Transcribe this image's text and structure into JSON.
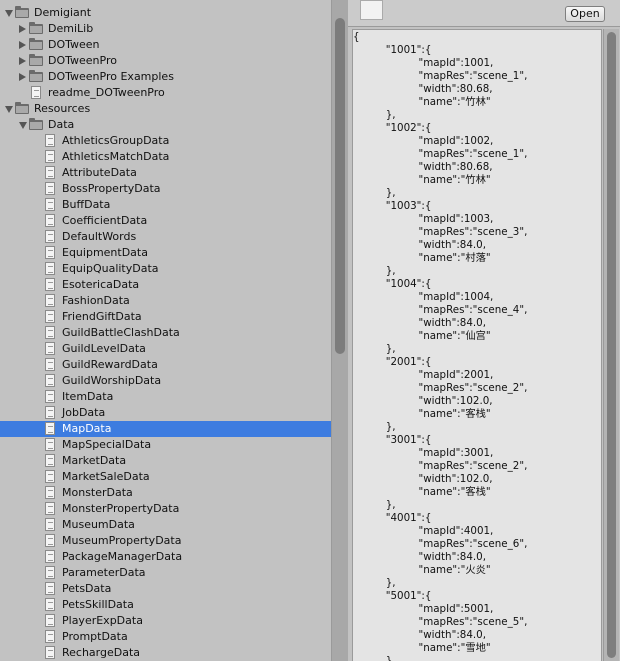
{
  "project_tree": [
    {
      "label": "Demigiant",
      "type": "folder",
      "depth": 0,
      "expander": "down"
    },
    {
      "label": "DemiLib",
      "type": "folder",
      "depth": 1,
      "expander": "right"
    },
    {
      "label": "DOTween",
      "type": "folder",
      "depth": 1,
      "expander": "right"
    },
    {
      "label": "DOTweenPro",
      "type": "folder",
      "depth": 1,
      "expander": "right"
    },
    {
      "label": "DOTweenPro Examples",
      "type": "folder",
      "depth": 1,
      "expander": "right"
    },
    {
      "label": "readme_DOTweenPro",
      "type": "file",
      "depth": 1
    },
    {
      "label": "Resources",
      "type": "folder",
      "depth": 0,
      "expander": "down"
    },
    {
      "label": "Data",
      "type": "folder",
      "depth": 1,
      "expander": "down"
    },
    {
      "label": "AthleticsGroupData",
      "type": "file",
      "depth": 2
    },
    {
      "label": "AthleticsMatchData",
      "type": "file",
      "depth": 2
    },
    {
      "label": "AttributeData",
      "type": "file",
      "depth": 2
    },
    {
      "label": "BossPropertyData",
      "type": "file",
      "depth": 2
    },
    {
      "label": "BuffData",
      "type": "file",
      "depth": 2
    },
    {
      "label": "CoefficientData",
      "type": "file",
      "depth": 2
    },
    {
      "label": "DefaultWords",
      "type": "file",
      "depth": 2
    },
    {
      "label": "EquipmentData",
      "type": "file",
      "depth": 2
    },
    {
      "label": "EquipQualityData",
      "type": "file",
      "depth": 2
    },
    {
      "label": "EsotericaData",
      "type": "file",
      "depth": 2
    },
    {
      "label": "FashionData",
      "type": "file",
      "depth": 2
    },
    {
      "label": "FriendGiftData",
      "type": "file",
      "depth": 2
    },
    {
      "label": "GuildBattleClashData",
      "type": "file",
      "depth": 2
    },
    {
      "label": "GuildLevelData",
      "type": "file",
      "depth": 2
    },
    {
      "label": "GuildRewardData",
      "type": "file",
      "depth": 2
    },
    {
      "label": "GuildWorshipData",
      "type": "file",
      "depth": 2
    },
    {
      "label": "ItemData",
      "type": "file",
      "depth": 2
    },
    {
      "label": "JobData",
      "type": "file",
      "depth": 2
    },
    {
      "label": "MapData",
      "type": "file",
      "depth": 2,
      "selected": true
    },
    {
      "label": "MapSpecialData",
      "type": "file",
      "depth": 2
    },
    {
      "label": "MarketData",
      "type": "file",
      "depth": 2
    },
    {
      "label": "MarketSaleData",
      "type": "file",
      "depth": 2
    },
    {
      "label": "MonsterData",
      "type": "file",
      "depth": 2
    },
    {
      "label": "MonsterPropertyData",
      "type": "file",
      "depth": 2
    },
    {
      "label": "MuseumData",
      "type": "file",
      "depth": 2
    },
    {
      "label": "MuseumPropertyData",
      "type": "file",
      "depth": 2
    },
    {
      "label": "PackageManagerData",
      "type": "file",
      "depth": 2
    },
    {
      "label": "ParameterData",
      "type": "file",
      "depth": 2
    },
    {
      "label": "PetsData",
      "type": "file",
      "depth": 2
    },
    {
      "label": "PetsSkillData",
      "type": "file",
      "depth": 2
    },
    {
      "label": "PlayerExpData",
      "type": "file",
      "depth": 2
    },
    {
      "label": "PromptData",
      "type": "file",
      "depth": 2
    },
    {
      "label": "RechargeData",
      "type": "file",
      "depth": 2
    }
  ],
  "inspector": {
    "open_button": "Open",
    "json_lines": [
      "{",
      "\t\"1001\":{",
      "\t\t\"mapId\":1001,",
      "\t\t\"mapRes\":\"scene_1\",",
      "\t\t\"width\":80.68,",
      "\t\t\"name\":\"竹林\"",
      "\t},",
      "\t\"1002\":{",
      "\t\t\"mapId\":1002,",
      "\t\t\"mapRes\":\"scene_1\",",
      "\t\t\"width\":80.68,",
      "\t\t\"name\":\"竹林\"",
      "\t},",
      "\t\"1003\":{",
      "\t\t\"mapId\":1003,",
      "\t\t\"mapRes\":\"scene_3\",",
      "\t\t\"width\":84.0,",
      "\t\t\"name\":\"村落\"",
      "\t},",
      "\t\"1004\":{",
      "\t\t\"mapId\":1004,",
      "\t\t\"mapRes\":\"scene_4\",",
      "\t\t\"width\":84.0,",
      "\t\t\"name\":\"仙宫\"",
      "\t},",
      "\t\"2001\":{",
      "\t\t\"mapId\":2001,",
      "\t\t\"mapRes\":\"scene_2\",",
      "\t\t\"width\":102.0,",
      "\t\t\"name\":\"客栈\"",
      "\t},",
      "\t\"3001\":{",
      "\t\t\"mapId\":3001,",
      "\t\t\"mapRes\":\"scene_2\",",
      "\t\t\"width\":102.0,",
      "\t\t\"name\":\"客栈\"",
      "\t},",
      "\t\"4001\":{",
      "\t\t\"mapId\":4001,",
      "\t\t\"mapRes\":\"scene_6\",",
      "\t\t\"width\":84.0,",
      "\t\t\"name\":\"火炎\"",
      "\t},",
      "\t\"5001\":{",
      "\t\t\"mapId\":5001,",
      "\t\t\"mapRes\":\"scene_5\",",
      "\t\t\"width\":84.0,",
      "\t\t\"name\":\"雪地\"",
      "\t},"
    ]
  },
  "colors": {
    "panel_bg": "#c2c2c2",
    "selection": "#3d7ce0",
    "json_bg": "#e4e4e4"
  }
}
